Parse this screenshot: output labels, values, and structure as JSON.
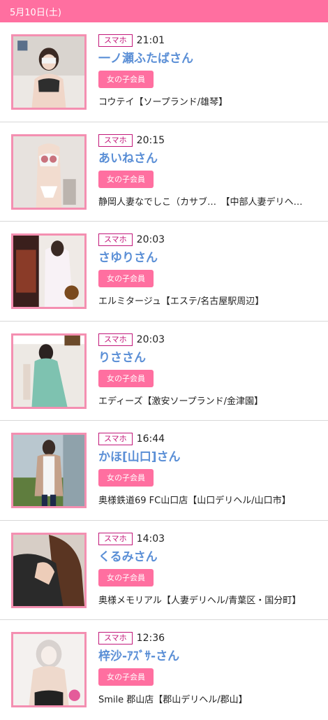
{
  "header": {
    "date": "5月10日(土)"
  },
  "colors": {
    "accent": "#ff6fa0",
    "badge_border": "#c2187a",
    "name": "#5b8fd6",
    "thumb_border": "#f48fb1"
  },
  "items": [
    {
      "device": "スマホ",
      "time": "21:01",
      "name": "一ノ瀬ふたばさん",
      "member": "女の子会員",
      "shop": "コウテイ【ソープランド/雄琴】",
      "thumb_icon": "photo-thumbnail"
    },
    {
      "device": "スマホ",
      "time": "20:15",
      "name": "あいねさん",
      "member": "女の子会員",
      "shop": "静岡人妻なでしこ（カサブ…　【中部人妻デリヘ…",
      "thumb_icon": "photo-thumbnail"
    },
    {
      "device": "スマホ",
      "time": "20:03",
      "name": "さゆりさん",
      "member": "女の子会員",
      "shop": "エルミタージュ【エステ/名古屋駅周辺】",
      "thumb_icon": "photo-thumbnail"
    },
    {
      "device": "スマホ",
      "time": "20:03",
      "name": "りささん",
      "member": "女の子会員",
      "shop": "エディーズ【激安ソープランド/金津園】",
      "thumb_icon": "photo-thumbnail"
    },
    {
      "device": "スマホ",
      "time": "16:44",
      "name": "かほ[山口]さん",
      "member": "女の子会員",
      "shop": "奥様鉄道69 FC山口店【山口デリヘル/山口市】",
      "thumb_icon": "photo-thumbnail"
    },
    {
      "device": "スマホ",
      "time": "14:03",
      "name": "くるみさん",
      "member": "女の子会員",
      "shop": "奥様メモリアル【人妻デリヘル/青葉区・国分町】",
      "thumb_icon": "photo-thumbnail"
    },
    {
      "device": "スマホ",
      "time": "12:36",
      "name": "梓沙-ｱｽﾞｻ-さん",
      "member": "女の子会員",
      "shop": "Smile 郡山店【郡山デリヘル/郡山】",
      "thumb_icon": "photo-thumbnail"
    }
  ]
}
